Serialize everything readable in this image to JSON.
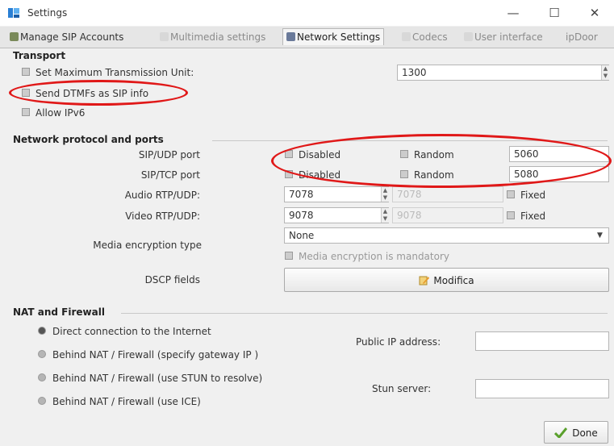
{
  "window": {
    "title": "Settings",
    "minimize": "—",
    "maximize": "☐",
    "close": "✕"
  },
  "tabs": [
    "Manage SIP Accounts",
    "Multimedia settings",
    "Network Settings",
    "Codecs",
    "User interface",
    "ipDoor"
  ],
  "transport": {
    "heading": "Transport",
    "mtu_label": "Set Maximum Transmission Unit:",
    "mtu_value": "1300",
    "dtmf_label": "Send DTMFs as SIP info",
    "ipv6_label": "Allow IPv6"
  },
  "ports": {
    "heading": "Network protocol and ports",
    "sip_udp_label": "SIP/UDP port",
    "sip_tcp_label": "SIP/TCP port",
    "audio_label": "Audio RTP/UDP:",
    "video_label": "Video RTP/UDP:",
    "disabled": "Disabled",
    "random": "Random",
    "fixed": "Fixed",
    "sip_udp_value": "5060",
    "sip_tcp_value": "5080",
    "audio_min": "7078",
    "audio_max": "7078",
    "video_min": "9078",
    "video_max": "9078",
    "encryption_label": "Media encryption type",
    "encryption_value": "None",
    "encryption_mandatory": "Media encryption is mandatory",
    "dscp_label": "DSCP fields",
    "dscp_button": "Modifica"
  },
  "nat": {
    "heading": "NAT and Firewall",
    "options": [
      "Direct connection to the Internet",
      "Behind NAT / Firewall (specify gateway IP )",
      "Behind NAT / Firewall (use STUN to resolve)",
      "Behind NAT / Firewall (use ICE)"
    ],
    "public_ip_label": "Public IP address:",
    "public_ip_value": "",
    "stun_label": "Stun server:",
    "stun_value": ""
  },
  "footer": {
    "done": "Done"
  },
  "colors": {
    "highlight": "#e01818",
    "check_green": "#5aa02c"
  }
}
